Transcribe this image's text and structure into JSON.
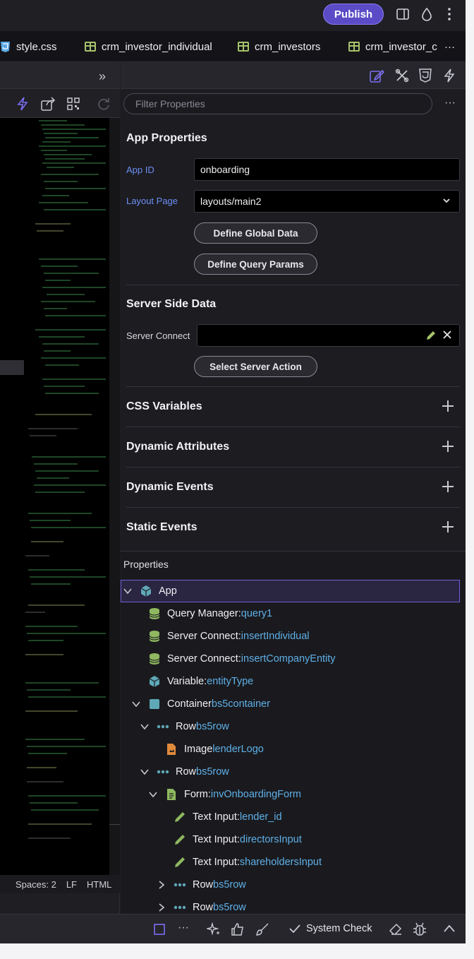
{
  "topbar": {
    "publish_label": "Publish"
  },
  "tabs": [
    {
      "label": "style.css",
      "icon": "css-file-icon"
    },
    {
      "label": "crm_investor_individual",
      "icon": "table-icon"
    },
    {
      "label": "crm_investors",
      "icon": "table-icon"
    },
    {
      "label": "crm_investor_c",
      "icon": "table-icon"
    }
  ],
  "tab_overflow": "···",
  "editor_status": {
    "spaces": "Spaces: 2",
    "eol": "LF",
    "language": "HTML"
  },
  "filter": {
    "placeholder": "Filter Properties"
  },
  "app_properties": {
    "title": "App Properties",
    "app_id_label": "App ID",
    "app_id_value": "onboarding",
    "layout_label": "Layout Page",
    "layout_value": "layouts/main2",
    "define_global_data": "Define Global Data",
    "define_query_params": "Define Query Params"
  },
  "server_side": {
    "title": "Server Side Data",
    "server_connect_label": "Server Connect",
    "select_action": "Select Server Action"
  },
  "sections": {
    "css_variables": "CSS Variables",
    "dynamic_attributes": "Dynamic Attributes",
    "dynamic_events": "Dynamic Events",
    "static_events": "Static Events"
  },
  "properties_header": "Properties",
  "tree": [
    {
      "type": "App",
      "value": ""
    },
    {
      "type": "Query Manager: ",
      "value": "query1"
    },
    {
      "type": "Server Connect: ",
      "value": "insertIndividual"
    },
    {
      "type": "Server Connect: ",
      "value": "insertCompanyEntity"
    },
    {
      "type": "Variable: ",
      "value": "entityType"
    },
    {
      "type": "Container ",
      "value": "bs5container"
    },
    {
      "type": "Row ",
      "value": "bs5row"
    },
    {
      "type": "Image ",
      "value": "lenderLogo"
    },
    {
      "type": "Row ",
      "value": "bs5row"
    },
    {
      "type": "Form: ",
      "value": "invOnboardingForm"
    },
    {
      "type": "Text Input: ",
      "value": "lender_id"
    },
    {
      "type": "Text Input: ",
      "value": "directorsInput"
    },
    {
      "type": "Text Input: ",
      "value": "shareholdersInput"
    },
    {
      "type": "Row ",
      "value": "bs5row"
    },
    {
      "type": "Row ",
      "value": "bs5row"
    }
  ],
  "bottombar": {
    "system_check": "System Check",
    "more": "···"
  },
  "colors": {
    "accent": "#5b4bc6",
    "value_blue": "#5fb0e8",
    "selection_border": "#6d5fd6"
  }
}
